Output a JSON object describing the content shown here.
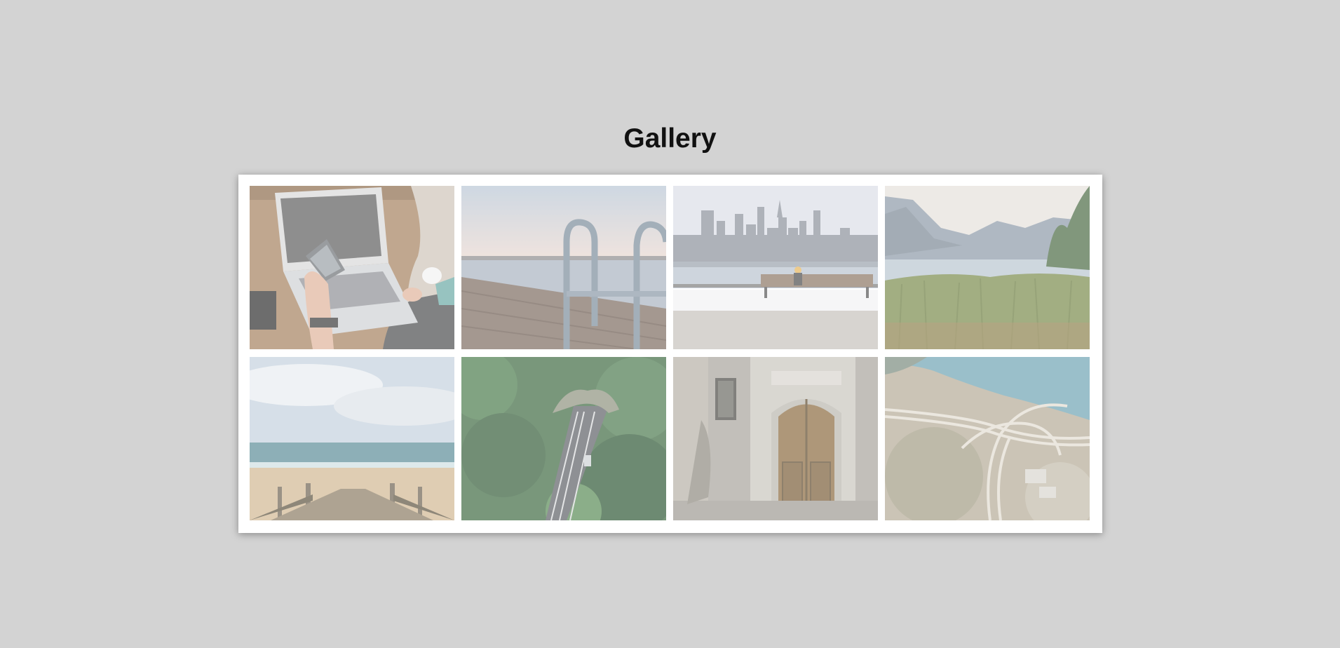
{
  "page": {
    "title": "Gallery"
  },
  "gallery": {
    "items": [
      {
        "name": "laptop-phone-photo"
      },
      {
        "name": "dock-ladder-photo"
      },
      {
        "name": "city-bench-photo"
      },
      {
        "name": "lake-mountains-photo"
      },
      {
        "name": "beach-stairs-photo"
      },
      {
        "name": "forest-tunnel-photo"
      },
      {
        "name": "old-door-photo"
      },
      {
        "name": "highway-aerial-photo"
      }
    ]
  },
  "colors": {
    "background": "#d3d3d3",
    "card": "#ffffff",
    "title": "#111111"
  }
}
